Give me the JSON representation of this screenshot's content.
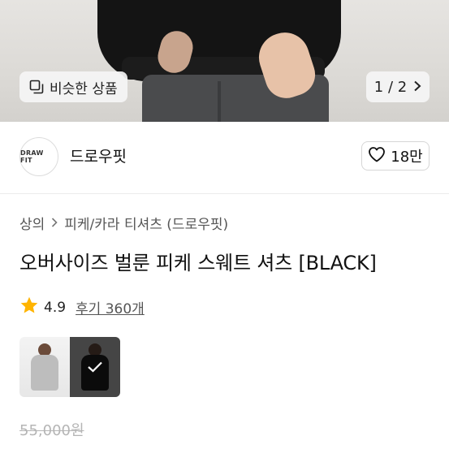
{
  "hero": {
    "similar_label": "비슷한 상품",
    "pager": "1 / 2"
  },
  "brand": {
    "logo_text": "DRAW FIT",
    "name": "드로우핏",
    "like_count": "18만"
  },
  "breadcrumb": {
    "category": "상의",
    "subcategory": "피케/카라 티셔츠 (드로우핏)"
  },
  "product": {
    "title": "오버사이즈 벌룬 피케 스웨트 셔츠 [BLACK]",
    "rating": "4.9",
    "reviews": "후기 360개",
    "original_price": "55,000원"
  },
  "colors": {
    "star": "#ffb400",
    "sale": "#ff3b3b"
  }
}
